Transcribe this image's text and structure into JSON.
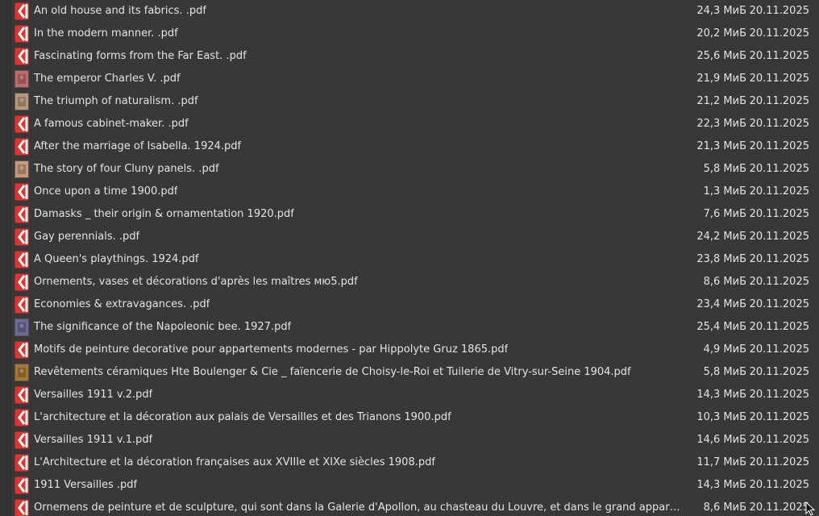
{
  "files": [
    {
      "name": "An old house and its fabrics. .pdf",
      "size": "24,3 МиБ",
      "date": "20.11.2025",
      "icon": "pdf-icon"
    },
    {
      "name": "In the modern manner. .pdf",
      "size": "20,2 МиБ",
      "date": "20.11.2025",
      "icon": "pdf-icon"
    },
    {
      "name": "Fascinating forms from the Far East. .pdf",
      "size": "25,6 МиБ",
      "date": "20.11.2025",
      "icon": "pdf-icon"
    },
    {
      "name": "The emperor Charles V. .pdf",
      "size": "21,9 МиБ",
      "date": "20.11.2025",
      "icon": "thumbnail",
      "thumb_color": "#c06a6a"
    },
    {
      "name": "The triumph of naturalism. .pdf",
      "size": "21,2 МиБ",
      "date": "20.11.2025",
      "icon": "thumbnail",
      "thumb_color": "#b89a78"
    },
    {
      "name": "A famous cabinet-maker. .pdf",
      "size": "22,3 МиБ",
      "date": "20.11.2025",
      "icon": "pdf-icon"
    },
    {
      "name": "After the marriage of Isabella. 1924.pdf",
      "size": "21,3 МиБ",
      "date": "20.11.2025",
      "icon": "pdf-icon"
    },
    {
      "name": "The story of four Cluny panels. .pdf",
      "size": "5,8 МиБ",
      "date": "20.11.2025",
      "icon": "thumbnail",
      "thumb_color": "#c9987a"
    },
    {
      "name": "Once upon a time 1900.pdf",
      "size": "1,3 МиБ",
      "date": "20.11.2025",
      "icon": "pdf-icon"
    },
    {
      "name": "Damasks _ their origin & ornamentation 1920.pdf",
      "size": "7,6 МиБ",
      "date": "20.11.2025",
      "icon": "pdf-icon"
    },
    {
      "name": "Gay perennials. .pdf",
      "size": "24,2 МиБ",
      "date": "20.11.2025",
      "icon": "pdf-icon"
    },
    {
      "name": "A Queen's playthings. 1924.pdf",
      "size": "23,8 МиБ",
      "date": "20.11.2025",
      "icon": "pdf-icon"
    },
    {
      "name": "Ornements, vases et décorations d'après les maîtres  мю5.pdf",
      "size": "8,6 МиБ",
      "date": "20.11.2025",
      "icon": "pdf-icon"
    },
    {
      "name": "Economies & extravagances. .pdf",
      "size": "23,4 МиБ",
      "date": "20.11.2025",
      "icon": "pdf-icon"
    },
    {
      "name": "The significance of the Napoleonic bee. 1927.pdf",
      "size": "25,4 МиБ",
      "date": "20.11.2025",
      "icon": "thumbnail",
      "thumb_color": "#6a6a9a"
    },
    {
      "name": "Motifs de peinture decorative pour appartements modernes - par Hippolyte Gruz 1865.pdf",
      "size": "4,9 МиБ",
      "date": "20.11.2025",
      "icon": "pdf-icon"
    },
    {
      "name": "Revêtements céramiques Hte Boulenger & Cie _ faïencerie de Choisy-le-Roi et Tuilerie de Vitry-sur-Seine 1904.pdf",
      "size": "5,8 МиБ",
      "date": "20.11.2025",
      "icon": "thumbnail",
      "thumb_color": "#a9782e"
    },
    {
      "name": "Versailles  1911 v.2.pdf",
      "size": "14,3 МиБ",
      "date": "20.11.2025",
      "icon": "pdf-icon"
    },
    {
      "name": "L'architecture et la décoration aux palais de Versailles et des Trianons  1900.pdf",
      "size": "10,3 МиБ",
      "date": "20.11.2025",
      "icon": "pdf-icon"
    },
    {
      "name": "Versailles 1911 v.1.pdf",
      "size": "14,6 МиБ",
      "date": "20.11.2025",
      "icon": "pdf-icon"
    },
    {
      "name": "L'Architecture et la décoration françaises aux XVIIIe et XIXe siècles 1908.pdf",
      "size": "11,7 МиБ",
      "date": "20.11.2025",
      "icon": "pdf-icon"
    },
    {
      "name": "1911 Versailles .pdf",
      "size": "14,3 МиБ",
      "date": "20.11.2025",
      "icon": "pdf-icon"
    },
    {
      "name": "Ornemens de peinture et de sculpture, qui sont dans la Galerie d'Apollon, au chasteau du Louvre, et dans le grand appartement du Roi.pdf",
      "size": "8,6 МиБ",
      "date": "20.11.2025",
      "icon": "pdf-icon"
    }
  ],
  "colors": {
    "background": "#383838",
    "text": "#e4e4e4",
    "pdf_icon": "#e0332b"
  }
}
